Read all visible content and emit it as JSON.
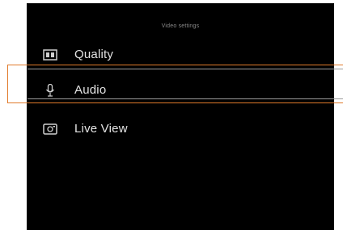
{
  "menu": {
    "title": "Video settings",
    "items": [
      {
        "label": "Quality",
        "icon": "quality-icon"
      },
      {
        "label": "Audio",
        "icon": "microphone-icon"
      },
      {
        "label": "Live View",
        "icon": "live-view-icon"
      }
    ],
    "selected_index": 1
  },
  "colors": {
    "screen_background": "#000000",
    "text": "#e4e4e4",
    "title_text": "#8a8a8a",
    "selection_outline": "#e07a2a"
  }
}
